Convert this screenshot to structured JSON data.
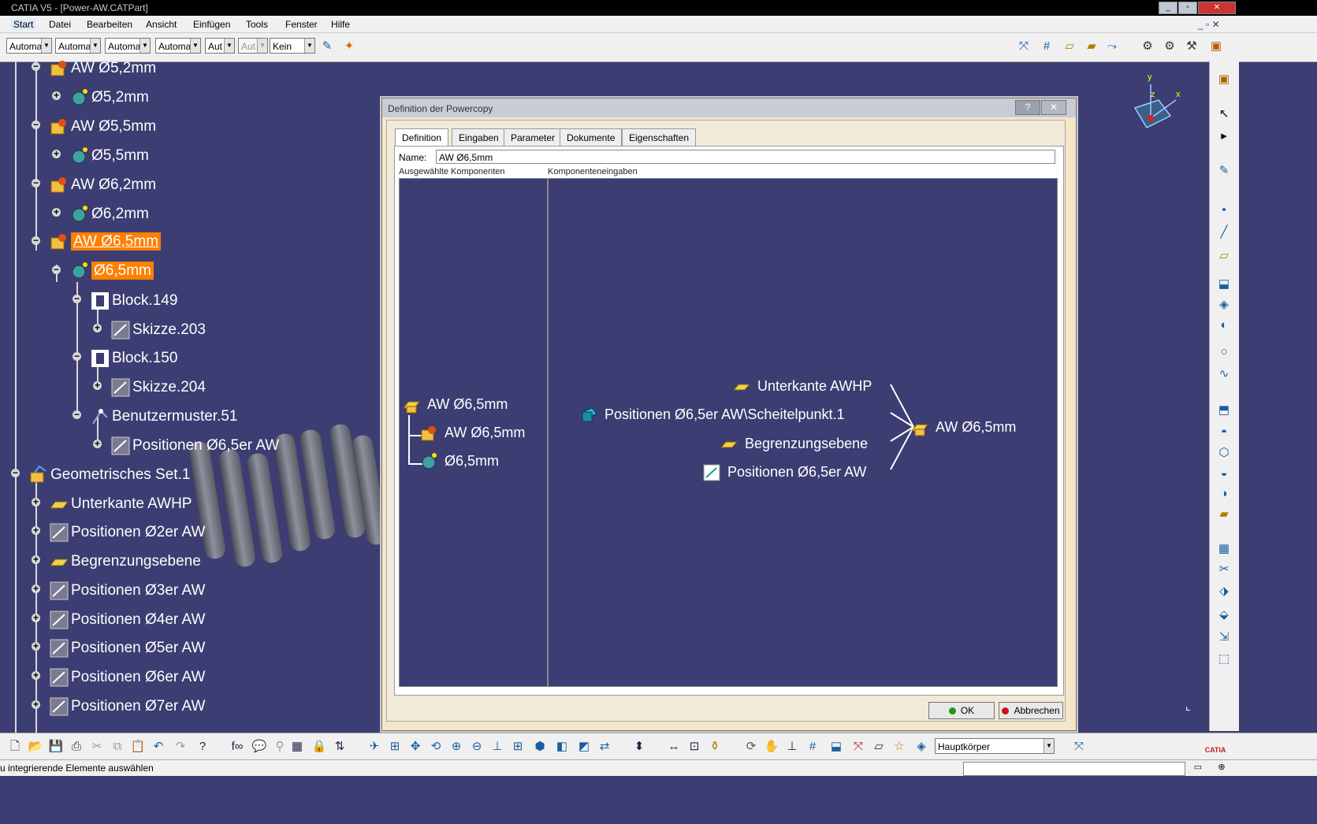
{
  "window": {
    "title": "CATIA V5 - [Power-AW.CATPart]",
    "min": "_",
    "max": "▫",
    "close": "✕"
  },
  "menubar": {
    "items": [
      "Start",
      "Datei",
      "Bearbeiten",
      "Ansicht",
      "Einfügen",
      "Tools",
      "Fenster",
      "Hilfe"
    ]
  },
  "toolbar_top": {
    "combos": [
      "Automa",
      "Automa",
      "Automa",
      "Automa",
      "Aut",
      "Aut",
      "Kein"
    ]
  },
  "tree": {
    "nodes": [
      {
        "label": "AW Ø5,2mm"
      },
      {
        "label": "Ø5,2mm"
      },
      {
        "label": "AW Ø5,5mm"
      },
      {
        "label": "Ø5,5mm"
      },
      {
        "label": "AW Ø6,2mm"
      },
      {
        "label": "Ø6,2mm"
      },
      {
        "label": "AW Ø6,5mm"
      },
      {
        "label": "Ø6,5mm"
      },
      {
        "label": "Block.149"
      },
      {
        "label": "Skizze.203"
      },
      {
        "label": "Block.150"
      },
      {
        "label": "Skizze.204"
      },
      {
        "label": "Benutzermuster.51"
      },
      {
        "label": "Positionen Ø6,5er AW"
      },
      {
        "label": "Geometrisches Set.1"
      },
      {
        "label": "Unterkante AWHP"
      },
      {
        "label": "Positionen Ø2er AW"
      },
      {
        "label": "Begrenzungsebene"
      },
      {
        "label": "Positionen Ø3er AW"
      },
      {
        "label": "Positionen Ø4er AW"
      },
      {
        "label": "Positionen Ø5er AW"
      },
      {
        "label": "Positionen Ø6er AW"
      },
      {
        "label": "Positionen Ø7er AW"
      }
    ]
  },
  "compass": {
    "x": "x",
    "y": "y",
    "z": "z"
  },
  "dialog": {
    "title": "Definition der Powercopy",
    "help_btn": "?",
    "close_btn": "✕",
    "tabs": [
      "Definition",
      "Eingaben",
      "Parameter",
      "Dokumente",
      "Eigenschaften"
    ],
    "name_label": "Name:",
    "name_value": "AW Ø6,5mm",
    "left_title": "Ausgewählte Komponenten",
    "right_title": "Komponenteneingaben",
    "components": [
      "AW Ø6,5mm",
      "AW Ø6,5mm",
      "Ø6,5mm"
    ],
    "inputs": [
      "Unterkante AWHP",
      "Positionen Ø6,5er AW\\Scheitelpunkt.1",
      "Begrenzungsebene",
      "Positionen Ø6,5er AW"
    ],
    "target": "AW Ø6,5mm",
    "ok": "OK",
    "cancel": "Abbrechen"
  },
  "bottom": {
    "body_combo": "Hauptkörper",
    "status": "u integrierende Elemente auswählen",
    "brand": "CATIA"
  }
}
